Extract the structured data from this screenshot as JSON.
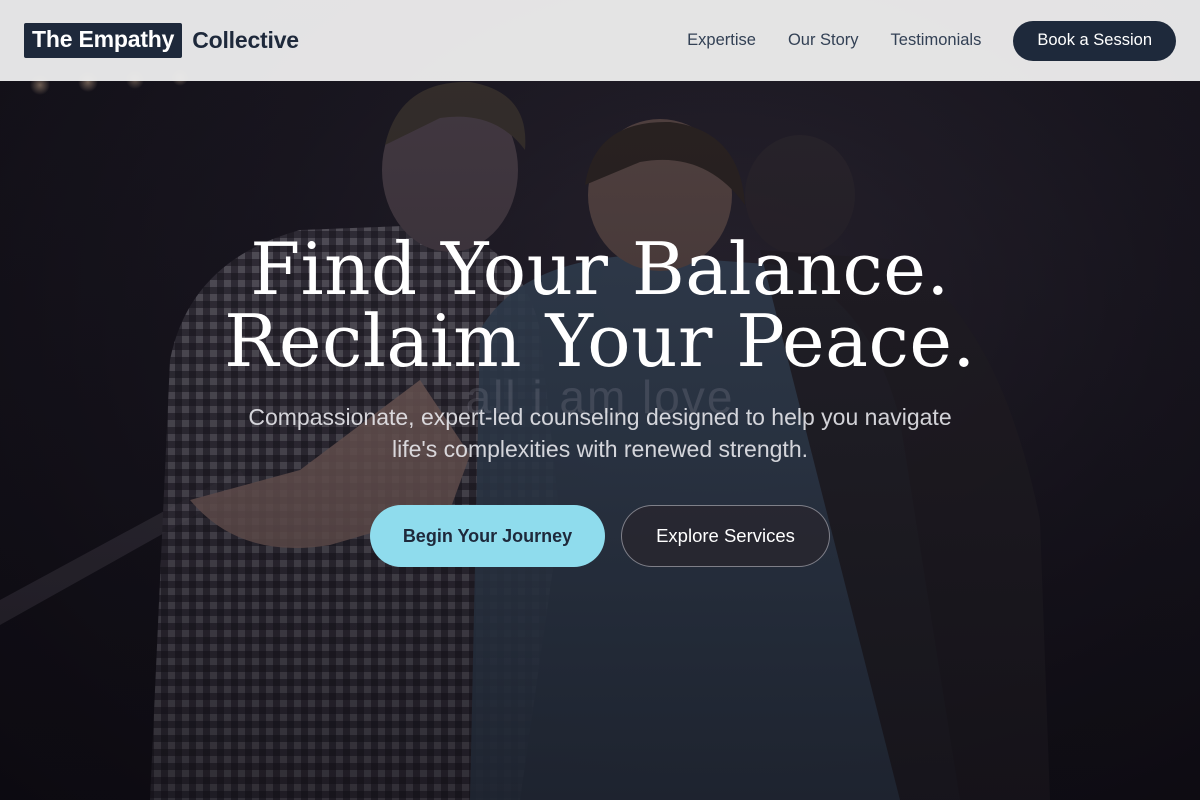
{
  "brand": {
    "part1": "The Empathy",
    "part2": "Collective"
  },
  "nav": {
    "links": [
      "Expertise",
      "Our Story",
      "Testimonials"
    ],
    "cta_label": "Book a Session"
  },
  "hero": {
    "headline_line1": "Find Your Balance.",
    "headline_line2": "Reclaim Your Peace.",
    "background_text": "all i am love",
    "subtext": "Compassionate, expert-led counseling designed to help you navigate life's complexities with renewed strength.",
    "primary_button": "Begin Your Journey",
    "secondary_button": "Explore Services",
    "background_image": "two-people-comforting-photo"
  },
  "colors": {
    "brand_dark": "#1e293b",
    "accent": "#8fdced",
    "navbar_bg": "#ececec"
  }
}
